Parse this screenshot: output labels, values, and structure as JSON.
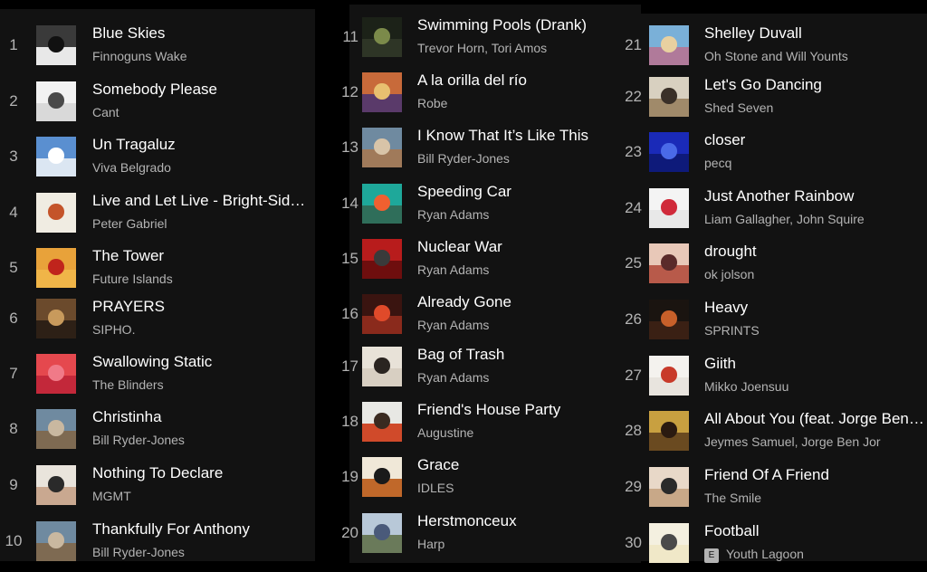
{
  "explicit_label": "E",
  "tracks": [
    {
      "number": "1",
      "title": "Blue Skies",
      "artist": "Finnoguns Wake",
      "explicit": false,
      "cover_colors": [
        "#3a3a3a",
        "#e8e8e8",
        "#111111"
      ]
    },
    {
      "number": "2",
      "title": "Somebody Please",
      "artist": "Cant",
      "explicit": false,
      "cover_colors": [
        "#f2f2f2",
        "#d9d9d9",
        "#4a4a4a"
      ]
    },
    {
      "number": "3",
      "title": "Un Tragaluz",
      "artist": "Viva Belgrado",
      "explicit": false,
      "cover_colors": [
        "#5a8fd0",
        "#dbe6f2",
        "#ffffff"
      ]
    },
    {
      "number": "4",
      "title": "Live and Let Live - Bright-Side Mix",
      "artist": "Peter Gabriel",
      "explicit": false,
      "cover_colors": [
        "#f0ece2",
        "#f0ece2",
        "#c4542a"
      ]
    },
    {
      "number": "5",
      "title": "The Tower",
      "artist": "Future Islands",
      "explicit": false,
      "cover_colors": [
        "#e8a23a",
        "#f0b548",
        "#c0241c"
      ]
    },
    {
      "number": "6",
      "title": "PRAYERS",
      "artist": "SIPHO.",
      "explicit": false,
      "cover_colors": [
        "#6b4a2c",
        "#2d2016",
        "#c89a5c"
      ]
    },
    {
      "number": "7",
      "title": "Swallowing Static",
      "artist": "The Blinders",
      "explicit": false,
      "cover_colors": [
        "#e5484e",
        "#c3283a",
        "#f07a88"
      ]
    },
    {
      "number": "8",
      "title": "Christinha",
      "artist": "Bill Ryder-Jones",
      "explicit": false,
      "cover_colors": [
        "#6f8aa0",
        "#7e6a52",
        "#c9b8a0"
      ]
    },
    {
      "number": "9",
      "title": "Nothing To Declare",
      "artist": "MGMT",
      "explicit": false,
      "cover_colors": [
        "#e9e4dc",
        "#c9a890",
        "#2a2a2a"
      ]
    },
    {
      "number": "10",
      "title": "Thankfully For Anthony",
      "artist": "Bill Ryder-Jones",
      "explicit": false,
      "cover_colors": [
        "#6f8aa0",
        "#7e6a52",
        "#c9b8a0"
      ]
    },
    {
      "number": "11",
      "title": "Swimming Pools (Drank)",
      "artist": "Trevor Horn, Tori Amos",
      "explicit": false,
      "cover_colors": [
        "#1c2218",
        "#2e3526",
        "#7b8a4a"
      ]
    },
    {
      "number": "12",
      "title": "A la orilla del río",
      "artist": "Robe",
      "explicit": false,
      "cover_colors": [
        "#c86a3a",
        "#5a3a6a",
        "#e8c070"
      ]
    },
    {
      "number": "13",
      "title": "I Know That It’s Like This",
      "artist": "Bill Ryder-Jones",
      "explicit": false,
      "cover_colors": [
        "#6f8aa0",
        "#a07a5a",
        "#d8c4a8"
      ]
    },
    {
      "number": "14",
      "title": "Speeding Car",
      "artist": "Ryan Adams",
      "explicit": false,
      "cover_colors": [
        "#1ea89a",
        "#2f6e5a",
        "#f06030"
      ]
    },
    {
      "number": "15",
      "title": "Nuclear War",
      "artist": "Ryan Adams",
      "explicit": false,
      "cover_colors": [
        "#b81c1c",
        "#6e0e0e",
        "#3a3a3a"
      ]
    },
    {
      "number": "16",
      "title": "Already Gone",
      "artist": "Ryan Adams",
      "explicit": false,
      "cover_colors": [
        "#3a1410",
        "#8a2a1c",
        "#e04a2a"
      ]
    },
    {
      "number": "17",
      "title": "Bag of Trash",
      "artist": "Ryan Adams",
      "explicit": false,
      "cover_colors": [
        "#e8e2d8",
        "#d8cfc2",
        "#2a2420"
      ]
    },
    {
      "number": "18",
      "title": "Friend's House Party",
      "artist": "Augustine",
      "explicit": false,
      "cover_colors": [
        "#e8e8e4",
        "#d04a2a",
        "#3a2a20"
      ]
    },
    {
      "number": "19",
      "title": "Grace",
      "artist": "IDLES",
      "explicit": false,
      "cover_colors": [
        "#f0e8d8",
        "#c0682a",
        "#1a1a1a"
      ]
    },
    {
      "number": "20",
      "title": "Herstmonceux",
      "artist": "Harp",
      "explicit": false,
      "cover_colors": [
        "#b8c8d8",
        "#6a7a5a",
        "#4a5a7a"
      ]
    },
    {
      "number": "21",
      "title": "Shelley Duvall",
      "artist": "Oh Stone and Will Younts",
      "explicit": false,
      "cover_colors": [
        "#7ab0d8",
        "#b07a9a",
        "#e8d0a0"
      ]
    },
    {
      "number": "22",
      "title": "Let's Go Dancing",
      "artist": "Shed Seven",
      "explicit": false,
      "cover_colors": [
        "#d8d0c0",
        "#a08a6a",
        "#3a3028"
      ]
    },
    {
      "number": "23",
      "title": "closer",
      "artist": "pecq",
      "explicit": false,
      "cover_colors": [
        "#1a2ab8",
        "#0e1a7a",
        "#4a6ae8"
      ]
    },
    {
      "number": "24",
      "title": "Just Another Rainbow",
      "artist": "Liam Gallagher, John Squire",
      "explicit": false,
      "cover_colors": [
        "#f4f4f4",
        "#e8e8e8",
        "#d02a3a"
      ]
    },
    {
      "number": "25",
      "title": "drought",
      "artist": "ok jolson",
      "explicit": false,
      "cover_colors": [
        "#e8c8b8",
        "#b85a4a",
        "#5a2a2a"
      ]
    },
    {
      "number": "26",
      "title": "Heavy",
      "artist": "SPRINTS",
      "explicit": false,
      "cover_colors": [
        "#1a1410",
        "#3a2014",
        "#c8602a"
      ]
    },
    {
      "number": "27",
      "title": "Giith",
      "artist": "Mikko Joensuu",
      "explicit": false,
      "cover_colors": [
        "#f4f2ee",
        "#e8e4de",
        "#c83a2a"
      ]
    },
    {
      "number": "28",
      "title": "All About You (feat. Jorge Ben Jor)",
      "artist": "Jeymes Samuel, Jorge Ben Jor",
      "explicit": false,
      "cover_colors": [
        "#c8a040",
        "#6a4a20",
        "#2a1a10"
      ]
    },
    {
      "number": "29",
      "title": "Friend Of A Friend",
      "artist": "The Smile",
      "explicit": false,
      "cover_colors": [
        "#e8d8c8",
        "#c8a888",
        "#2a2a2a"
      ]
    },
    {
      "number": "30",
      "title": "Football",
      "artist": "Youth Lagoon",
      "explicit": true,
      "cover_colors": [
        "#f4f0e0",
        "#f0e8c8",
        "#4a4a4a"
      ]
    }
  ]
}
